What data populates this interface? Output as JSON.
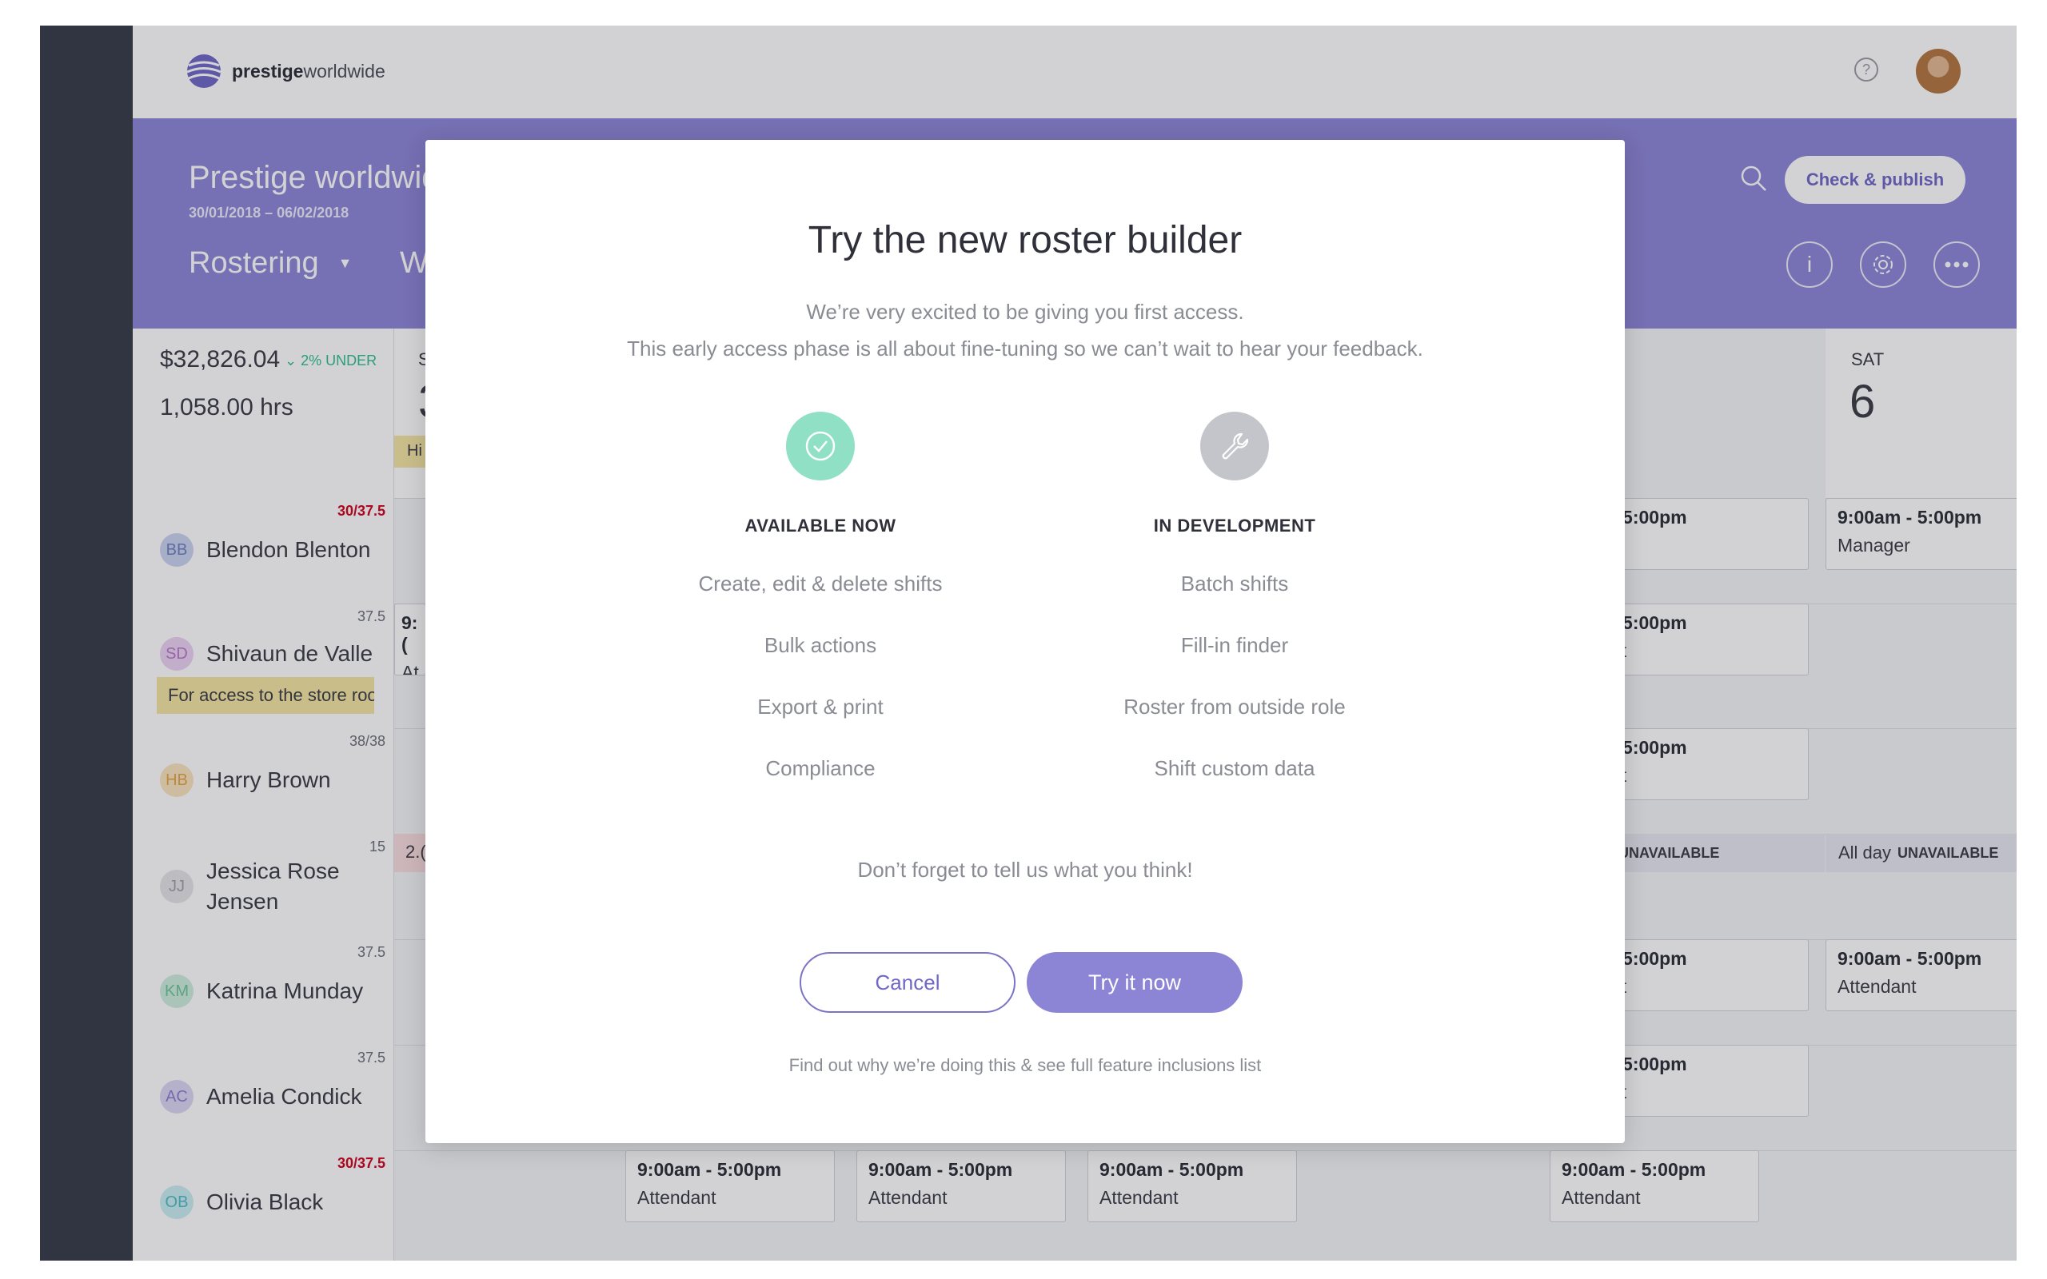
{
  "brand": {
    "name_bold": "prestige",
    "name_rest": "worldwide"
  },
  "header": {
    "title": "Prestige worldwide",
    "date_range": "30/01/2018 – 06/02/2018",
    "nav_rostering": "Rostering",
    "nav_next_partial": "W",
    "publish_label": "Check & publish",
    "info_label": "i"
  },
  "summary": {
    "cost": "$32,826.04",
    "under": "2% UNDER",
    "hours": "1,058.00 hrs"
  },
  "days": [
    {
      "name": "S",
      "num": "3"
    },
    {
      "name": "SAT",
      "num": "6"
    }
  ],
  "day_tag": "Hi",
  "employees": [
    {
      "initials": "BB",
      "name": "Blendon Blenton",
      "badge": "30/37.5",
      "badge_alert": true
    },
    {
      "initials": "SD",
      "name": "Shivaun de Valle",
      "badge": "37.5",
      "badge_alert": false,
      "note": "For access to the store room"
    },
    {
      "initials": "HB",
      "name": "Harry Brown",
      "badge": "38/38",
      "badge_alert": false
    },
    {
      "initials": "JJ",
      "name": "Jessica Rose Jensen",
      "name_l1": "Jessica Rose",
      "name_l2": "Jensen",
      "badge": "15",
      "badge_alert": false
    },
    {
      "initials": "KM",
      "name": "Katrina Munday",
      "badge": "37.5",
      "badge_alert": false
    },
    {
      "initials": "AC",
      "name": "Amelia Condick",
      "badge": "37.5",
      "badge_alert": false
    },
    {
      "initials": "OB",
      "name": "Olivia Black",
      "badge": "30/37.5",
      "badge_alert": true
    }
  ],
  "shifts": {
    "partial_time": "- 5:00pm",
    "full_time": "9:00am - 5:00pm",
    "role_manager": "Manager",
    "role_attendant": "Attendant",
    "role_r": "r",
    "role_nt": "nt",
    "sd_partial_time": "9:(",
    "sd_partial_role": "At",
    "jj_partial": "2.(",
    "unavailable_partial": "UNAVAILABLE",
    "all_day": "All day",
    "unavailable": "UNAVAILABLE"
  },
  "modal": {
    "title": "Try the new roster builder",
    "subtitle_1": "We’re very excited to be giving you first access.",
    "subtitle_2": "This early access phase is all about fine-tuning so we can’t wait to hear your feedback.",
    "available_title": "AVAILABLE NOW",
    "available_items": [
      "Create, edit & delete shifts",
      "Bulk actions",
      "Export & print",
      "Compliance"
    ],
    "dev_title": "IN DEVELOPMENT",
    "dev_items": [
      "Batch shifts",
      "Fill-in finder",
      "Roster from outside role",
      "Shift custom data"
    ],
    "cta_text": "Don’t forget to tell us what you think!",
    "cancel_label": "Cancel",
    "try_label": "Try it now",
    "footer_link": "Find out why we’re doing this & see full feature inclusions list"
  },
  "colors": {
    "accent": "#8c85d6",
    "sidebar": "#363a46",
    "available_green": "#8fe0c4",
    "dev_gray": "#c4c5cb",
    "alert_red": "#d0021b",
    "under_green": "#2fbf8a"
  }
}
